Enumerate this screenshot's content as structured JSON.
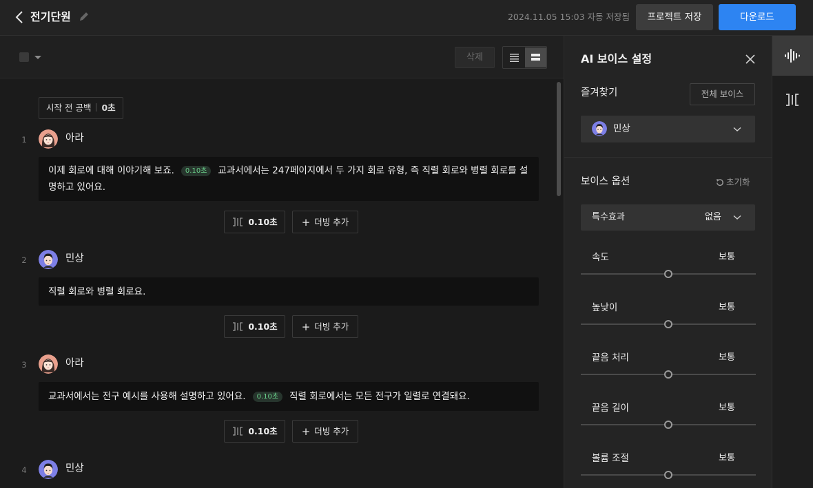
{
  "header": {
    "title": "전기단원",
    "autosave": "2024.11.05 15:03 자동 저장됨",
    "save_label": "프로젝트 저장",
    "download_label": "다운로드"
  },
  "toolbar": {
    "delete_label": "삭제"
  },
  "script": {
    "start_gap_label": "시작 전 공백",
    "start_gap_value": "0초",
    "dub_label": "더빙 추가",
    "lines": [
      {
        "no": "1",
        "speaker": "아라",
        "avatar": "female",
        "text_a": "이제 회로에 대해 이야기해 보죠.",
        "pause": "0.10초",
        "text_b": "교과서에서는 247페이지에서 두 가지 회로 유형, 즉 직렬 회로와 병렬 회로를 설명하고 있어요.",
        "gap": "0.10초"
      },
      {
        "no": "2",
        "speaker": "민상",
        "avatar": "male",
        "text_a": "직렬 회로와 병렬 회로요.",
        "gap": "0.10초"
      },
      {
        "no": "3",
        "speaker": "아라",
        "avatar": "female",
        "text_a": "교과서에서는 전구 예시를 사용해 설명하고 있어요.",
        "pause": "0.10초",
        "text_b": "직렬 회로에서는 모든 전구가 일렬로 연결돼요.",
        "gap": "0.10초"
      },
      {
        "no": "4",
        "speaker": "민상",
        "avatar": "male"
      }
    ]
  },
  "panel": {
    "title": "AI 보이스 설정",
    "favorites_label": "즐겨찾기",
    "all_voices_label": "전체 보이스",
    "selected_voice": "민상",
    "options_label": "보이스 옵션",
    "reset_label": "초기화",
    "effect_label": "특수효과",
    "effect_value": "없음",
    "params": [
      {
        "name": "속도",
        "value": "보통",
        "level": 0.5
      },
      {
        "name": "높낮이",
        "value": "보통",
        "level": 0.5
      },
      {
        "name": "끝음 처리",
        "value": "보통",
        "level": 0.5
      },
      {
        "name": "끝음 길이",
        "value": "보통",
        "level": 0.5
      },
      {
        "name": "볼륨 조절",
        "value": "보통",
        "level": 0.5
      }
    ]
  },
  "colors": {
    "accent": "#2d84f2",
    "pause_badge_text": "#6ad08a"
  }
}
